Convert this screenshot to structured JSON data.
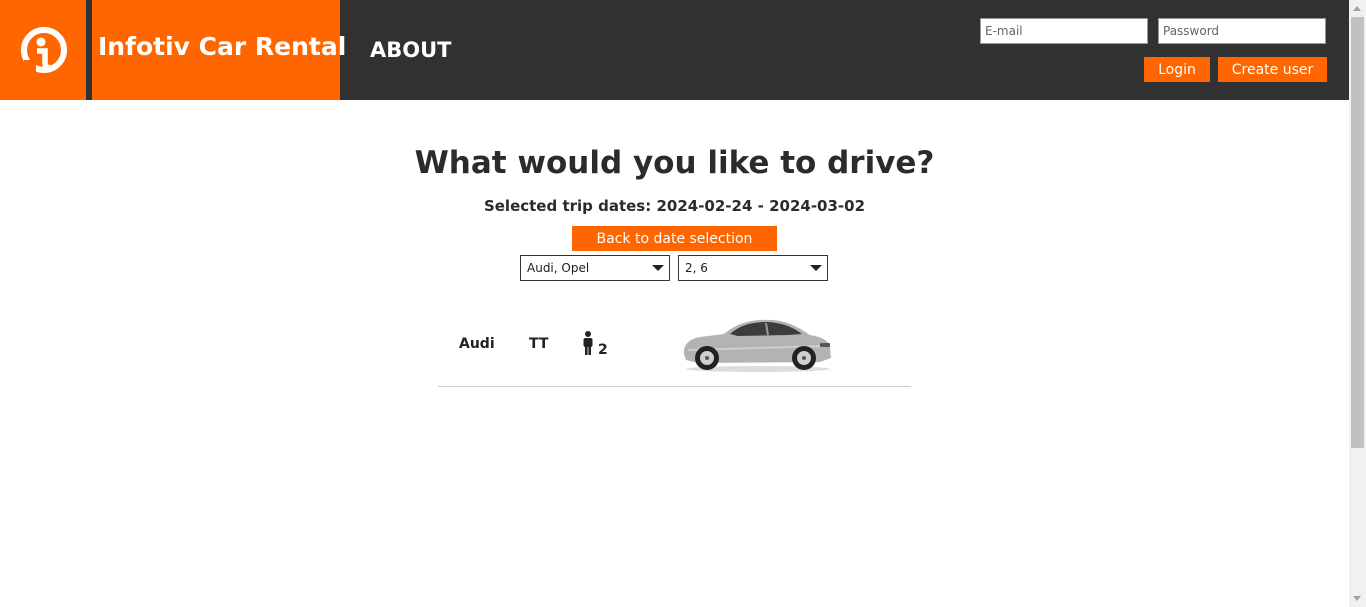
{
  "header": {
    "brand": "Infotiv Car Rental",
    "nav_about": "ABOUT",
    "email_placeholder": "E-mail",
    "password_placeholder": "Password",
    "login_label": "Login",
    "create_user_label": "Create user"
  },
  "main": {
    "title": "What would you like to drive?",
    "trip_dates": "Selected trip dates: 2024-02-24 - 2024-03-02",
    "back_label": "Back to date selection",
    "make_filter": "Audi, Opel",
    "seats_filter": "2, 6"
  },
  "cars": [
    {
      "make": "Audi",
      "model": "TT",
      "seats": "2"
    }
  ],
  "colors": {
    "accent": "#ff6600",
    "header_bg": "#313131"
  }
}
